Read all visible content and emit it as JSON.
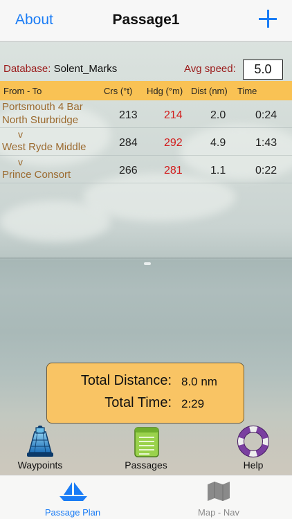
{
  "nav": {
    "about": "About",
    "title": "Passage1"
  },
  "database": {
    "label": "Database:",
    "value": "Solent_Marks"
  },
  "avg_speed": {
    "label": "Avg speed:",
    "value": "5.0"
  },
  "table": {
    "headers": [
      "From - To",
      "Crs (°t)",
      "Hdg (°m)",
      "Dist (nm)",
      "Time"
    ],
    "legs": [
      {
        "from": "Portsmouth 4 Bar",
        "to": "North Sturbridge",
        "crs": "213",
        "hdg": "214",
        "dist": "2.0",
        "time": "0:24"
      },
      {
        "from": "v",
        "to": "West Ryde Middle",
        "crs": "284",
        "hdg": "292",
        "dist": "4.9",
        "time": "1:43"
      },
      {
        "from": "v",
        "to": "Prince Consort",
        "crs": "266",
        "hdg": "281",
        "dist": "1.1",
        "time": "0:22"
      }
    ]
  },
  "totals": {
    "distance_label": "Total Distance:",
    "distance_value": "8.0 nm",
    "time_label": "Total Time:",
    "time_value": "2:29"
  },
  "shortcuts": [
    {
      "label": "Waypoints",
      "icon": "lighthouse-buoy-icon"
    },
    {
      "label": "Passages",
      "icon": "notepad-icon"
    },
    {
      "label": "Help",
      "icon": "lifebuoy-icon"
    }
  ],
  "tabs": [
    {
      "label": "Passage Plan",
      "icon": "sailboat-icon",
      "active": true
    },
    {
      "label": "Map - Nav",
      "icon": "map-icon",
      "active": false
    }
  ],
  "colors": {
    "accent": "#1a7cf5",
    "header": "#f9c254",
    "hdg": "#d21c1c",
    "place": "#9b6a2f",
    "label": "#9b1b1b"
  }
}
